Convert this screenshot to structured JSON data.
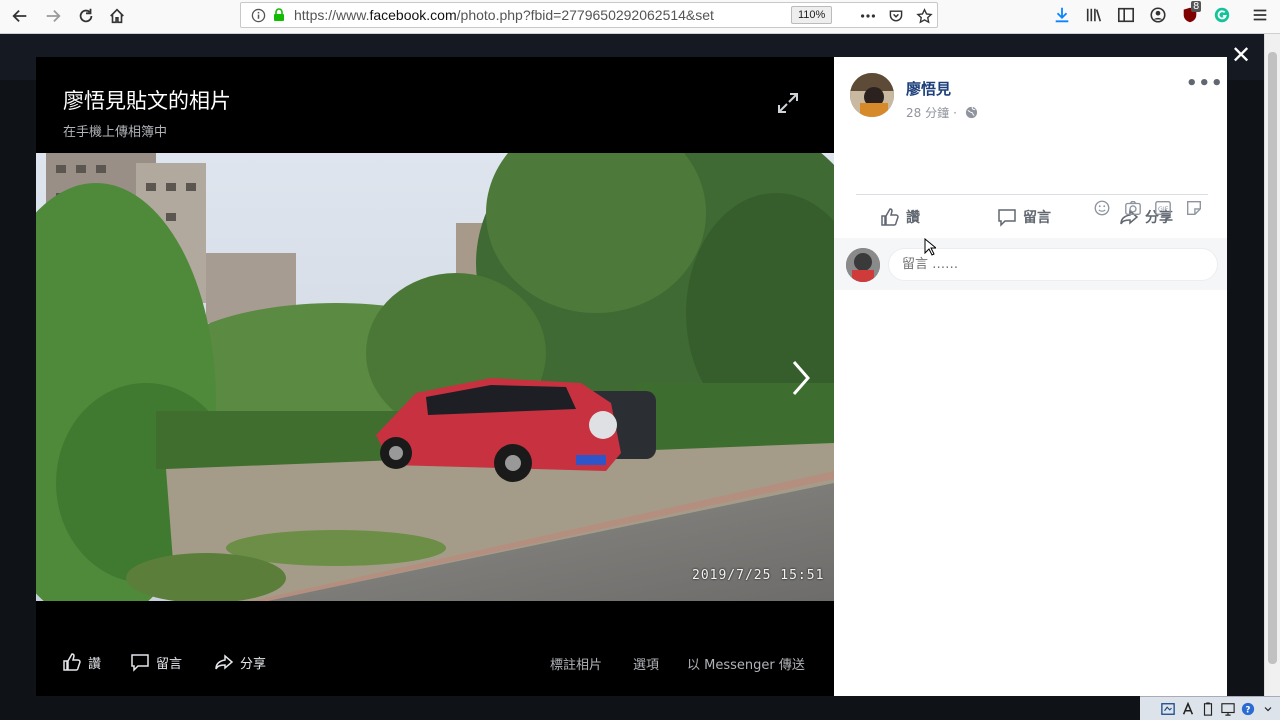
{
  "browser": {
    "url_prefix": "https://www.",
    "url_host": "facebook.com",
    "url_rest": "/photo.php?fbid=2779650292062514&set",
    "zoom": "110%",
    "icons": [
      "back-icon",
      "forward-icon",
      "reload-icon",
      "home-icon",
      "info-icon",
      "lock-icon",
      "page-actions-icon",
      "pocket-icon",
      "bookmark-star-icon",
      "download-icon",
      "library-icon",
      "sidebar-icon",
      "account-icon",
      "ublock-icon",
      "grammarly-icon",
      "menu-icon"
    ],
    "ublock_badge": "8"
  },
  "photo_viewer": {
    "title": "廖悟見貼文的相片",
    "subtitle": "在手機上傳相簿中",
    "timestamp": "2019/7/25  15:51",
    "actions": {
      "like": "讚",
      "comment": "留言",
      "share": "分享",
      "tag_photo": "標註相片",
      "options": "選項",
      "send_messenger": "以 Messenger 傳送"
    }
  },
  "post_panel": {
    "author": "廖悟見",
    "time": "28 分鐘",
    "separator": "·",
    "actions": {
      "like": "讚",
      "comment": "留言",
      "share": "分享"
    },
    "comment_placeholder": "留言 ……"
  },
  "colors": {
    "fb_blue": "#385898",
    "author_link": "#1c3f7a",
    "overlay_bg": "#0f1217",
    "panel_bg": "#ffffff"
  }
}
